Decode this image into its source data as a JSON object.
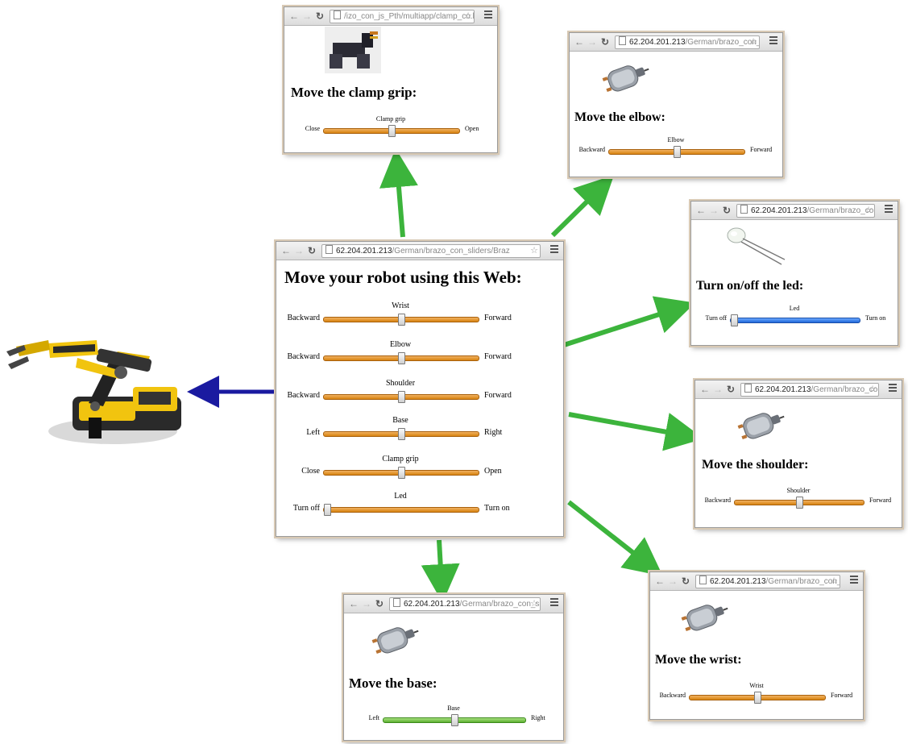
{
  "main": {
    "url_host": "62.204.201.213",
    "url_path": "/German/brazo_con_sliders/Braz",
    "title": "Move your robot using this Web:",
    "sliders": [
      {
        "label": "Wrist",
        "left": "Backward",
        "right": "Forward",
        "value": 0.5
      },
      {
        "label": "Elbow",
        "left": "Backward",
        "right": "Forward",
        "value": 0.5
      },
      {
        "label": "Shoulder",
        "left": "Backward",
        "right": "Forward",
        "value": 0.5
      },
      {
        "label": "Base",
        "left": "Left",
        "right": "Right",
        "value": 0.5
      },
      {
        "label": "Clamp grip",
        "left": "Close",
        "right": "Open",
        "value": 0.5
      },
      {
        "label": "Led",
        "left": "Turn off",
        "right": "Turn on",
        "value": 0
      }
    ]
  },
  "clamp_window": {
    "url_host": "",
    "url_path": "/izo_con_js_Pth/multiapp/clamp_co.html",
    "title": "Move the clamp grip:",
    "slider": {
      "label": "Clamp grip",
      "left": "Close",
      "right": "Open",
      "value": 0.5
    }
  },
  "elbow_window": {
    "url_host": "62.204.201.213",
    "url_path": "/German/brazo_con_slide",
    "title": "Move the elbow:",
    "slider": {
      "label": "Elbow",
      "left": "Backward",
      "right": "Forward",
      "value": 0.5
    }
  },
  "led_window": {
    "url_host": "62.204.201.213",
    "url_path": "/German/brazo_con_slide",
    "title": "Turn on/off the led:",
    "slider": {
      "label": "Led",
      "left": "Turn off",
      "right": "Turn on",
      "value": 0
    }
  },
  "shoulder_window": {
    "url_host": "62.204.201.213",
    "url_path": "/German/brazo_con_slide",
    "title": "Move the shoulder:",
    "slider": {
      "label": "Shoulder",
      "left": "Backward",
      "right": "Forward",
      "value": 0.5
    }
  },
  "wrist_window": {
    "url_host": "62.204.201.213",
    "url_path": "/German/brazo_con_slide",
    "title": "Move the wrist:",
    "slider": {
      "label": "Wrist",
      "left": "Backward",
      "right": "Forward",
      "value": 0.5
    }
  },
  "base_window": {
    "url_host": "62.204.201.213",
    "url_path": "/German/brazo_con_slide",
    "title": "Move the base:",
    "slider": {
      "label": "Base",
      "left": "Left",
      "right": "Right",
      "value": 0.5
    }
  },
  "icons": {
    "back": "back-arrow-icon",
    "forward": "forward-arrow-icon",
    "reload": "reload-icon",
    "page": "page-icon",
    "bookmark": "star-icon",
    "menu": "hamburger-menu-icon"
  },
  "colors": {
    "slider_orange": "#d88410",
    "slider_blue": "#1e66d8",
    "slider_green": "#5cb030",
    "arrow_green": "#3cb43c",
    "arrow_blue": "#1a1aa0"
  }
}
